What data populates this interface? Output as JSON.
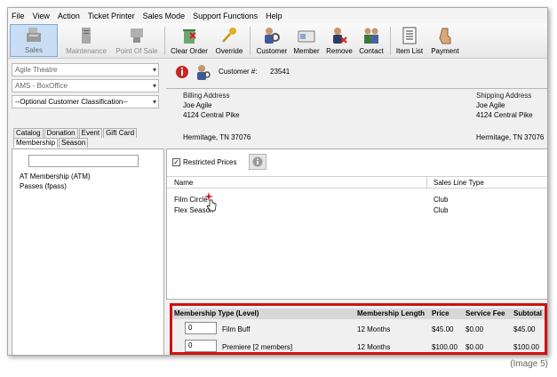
{
  "menu": [
    "File",
    "View",
    "Action",
    "Ticket Printer",
    "Sales Mode",
    "Support Functions",
    "Help"
  ],
  "toolbar": {
    "sales": "Sales",
    "maintenance": "Maintenance",
    "point_of_sale": "Point Of Sale",
    "clear_order": "Clear Order",
    "override": "Override",
    "customer": "Customer",
    "member": "Member",
    "remove": "Remove",
    "contact": "Contact",
    "item_list": "Item List",
    "payment": "Payment"
  },
  "left": {
    "venue": "Agile Theatre",
    "box_office": "AMS - BoxOffice",
    "classification": "--Optional Customer Classification--",
    "tabs_row1": [
      "Catalog",
      "Donation",
      "Event",
      "Gift Card"
    ],
    "tabs_row2": [
      "Membership",
      "Season"
    ],
    "tree": [
      "AT Membership  (ATM)",
      "Passes  (fpass)"
    ]
  },
  "customer": {
    "label": "Customer #:",
    "number": "23541",
    "billing_title": "Billing Address",
    "billing": [
      "Joe Agile",
      "4124 Central Pike",
      "Hermitage, TN 37076"
    ],
    "shipping_title": "Shipping Address",
    "shipping": [
      "Joe Agile",
      "4124 Central Pike",
      "Hermitage, TN 37076"
    ]
  },
  "grid": {
    "restricted_label": "Restricted Prices",
    "col_name": "Name",
    "col_type": "Sales Line Type",
    "rows": [
      {
        "name": "Film Circle",
        "type": "Club"
      },
      {
        "name": "Flex Season",
        "type": "Club"
      }
    ]
  },
  "membership": {
    "headers": [
      "Membership Type (Level)",
      "Membership Length",
      "Price",
      "Service Fee",
      "Subtotal"
    ],
    "rows": [
      {
        "qty": "0",
        "type": "Film Buff",
        "length": "12 Months",
        "price": "$45.00",
        "fee": "$0.00",
        "subtotal": "$45.00"
      },
      {
        "qty": "0",
        "type": "Premiere [2 members]",
        "length": "12 Months",
        "price": "$100.00",
        "fee": "$0.00",
        "subtotal": "$100.00"
      }
    ]
  },
  "caption": "(Image 5)",
  "colors": {
    "highlight_border": "#d01010",
    "active_tab_bg": "#c9def5"
  }
}
